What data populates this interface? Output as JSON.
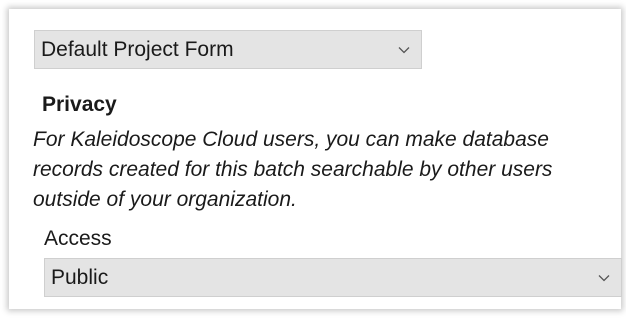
{
  "project_form_select": {
    "value": "Default Project Form",
    "icon": "chevron-down-icon"
  },
  "privacy": {
    "heading": "Privacy",
    "description": "For Kaleidoscope Cloud users, you can make database records created for this batch searchable by other users outside of your organization."
  },
  "access": {
    "label": "Access",
    "value": "Public",
    "icon": "chevron-down-icon"
  }
}
